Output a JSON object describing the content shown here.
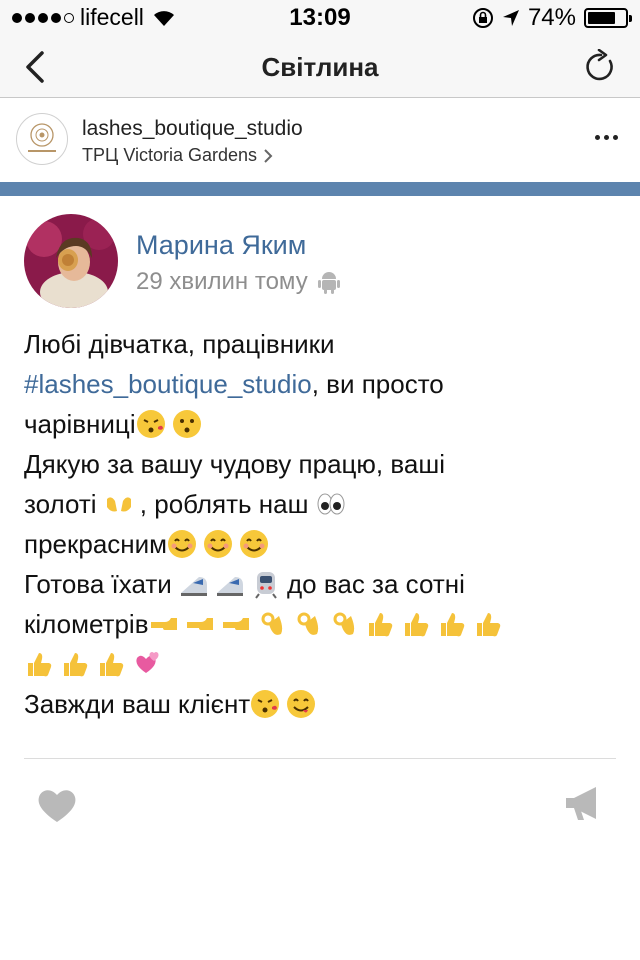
{
  "status_bar": {
    "carrier": "lifecell",
    "time": "13:09",
    "battery_percent": "74%",
    "battery_level": 0.74,
    "signal_bars_filled": 4,
    "icons": [
      "signal-icon",
      "wifi-icon",
      "lock-rotation-icon",
      "location-arrow-icon",
      "battery-icon"
    ]
  },
  "nav": {
    "title": "Світлина",
    "back_icon": "chevron-left-icon",
    "refresh_icon": "refresh-icon"
  },
  "post_header": {
    "account_name": "lashes_boutique_studio",
    "location": "ТРЦ Victoria Gardens",
    "location_chevron": "chevron-right-icon",
    "more_icon": "more-dots-icon"
  },
  "photo": {
    "author_name": "Марина Яким",
    "time_ago": "29 хвилин тому",
    "platform_icon": "android-icon",
    "text": {
      "line1": "Любі дівчатка, працівники",
      "hashtag": "#lashes_boutique_studio",
      "line2_rest": ", ви просто",
      "line3": "чарівниці",
      "line4": "Дякую за вашу чудову працю, ваші",
      "line5a": "золоті ",
      "line5b": ", роблять наш ",
      "line6": "прекрасним",
      "line7a": "Готова їхати ",
      "line7b": "до вас за сотні",
      "line8": "кілометрів",
      "line10": "Завжди ваш клієнт"
    },
    "like_icon": "heart-icon",
    "share_icon": "megaphone-icon"
  }
}
